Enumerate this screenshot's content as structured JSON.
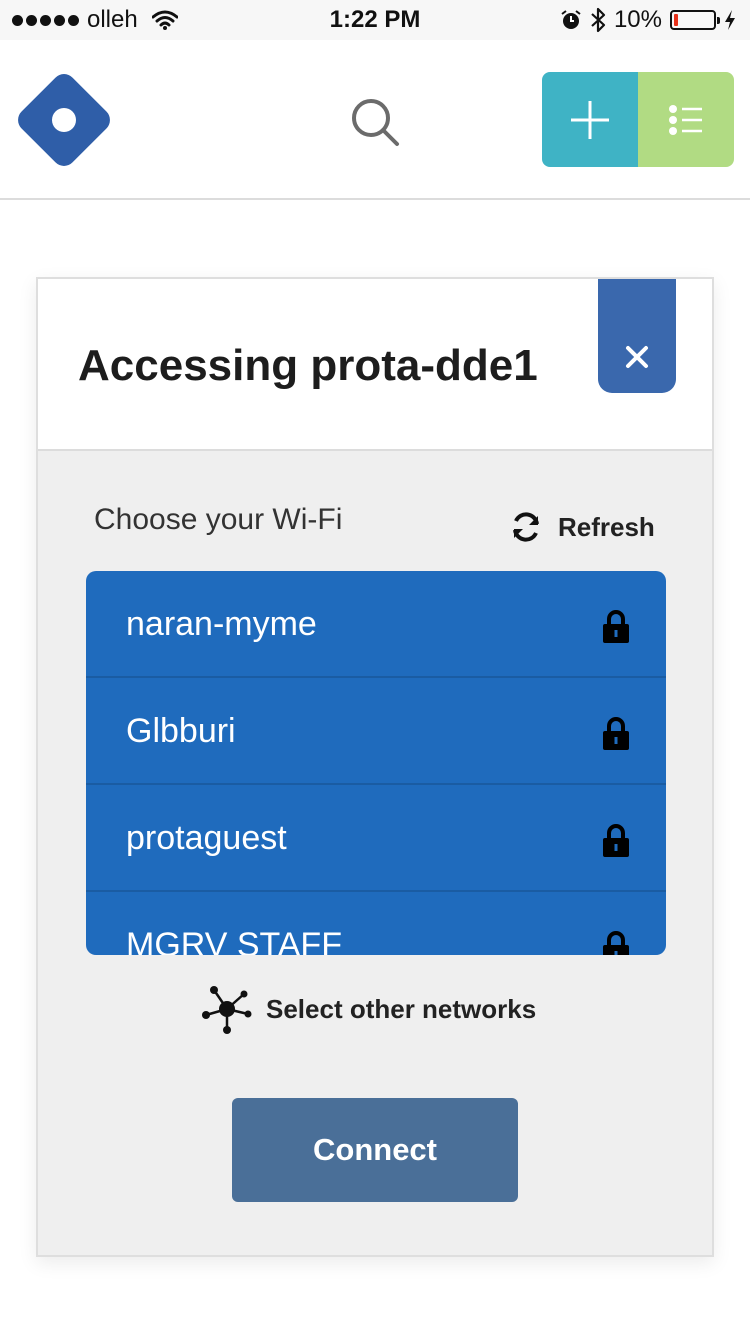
{
  "status_bar": {
    "carrier": "olleh",
    "time": "1:22 PM",
    "battery_percent": "10%",
    "battery_level": 0.1,
    "battery_color": "#e8311a",
    "icons": [
      "signal-dots-icon",
      "wifi-icon",
      "alarm-icon",
      "bluetooth-icon",
      "battery-icon",
      "charging-icon"
    ]
  },
  "header": {
    "logo_icon": "logo-diamond-icon",
    "search_icon": "search-icon",
    "add_icon": "plus-icon",
    "list_icon": "list-icon",
    "colors": {
      "logo": "#2f5ea8",
      "add": "#3fb3c5",
      "list": "#b1db83"
    }
  },
  "modal": {
    "title": "Accessing prota-dde1",
    "close_icon": "close-icon",
    "choose_label": "Choose your Wi-Fi",
    "refresh_label": "Refresh",
    "refresh_icon": "refresh-icon",
    "networks": [
      {
        "name": "naran-myme",
        "secured": true
      },
      {
        "name": "Glbburi",
        "secured": true
      },
      {
        "name": "protaguest",
        "secured": true
      },
      {
        "name": "MGRV STAFF",
        "secured": true
      }
    ],
    "other_networks_label": "Select other networks",
    "other_networks_icon": "network-nodes-icon",
    "connect_label": "Connect",
    "colors": {
      "list": "#1f6bbd",
      "close": "#3a68ad",
      "connect": "#4a6f98"
    }
  }
}
